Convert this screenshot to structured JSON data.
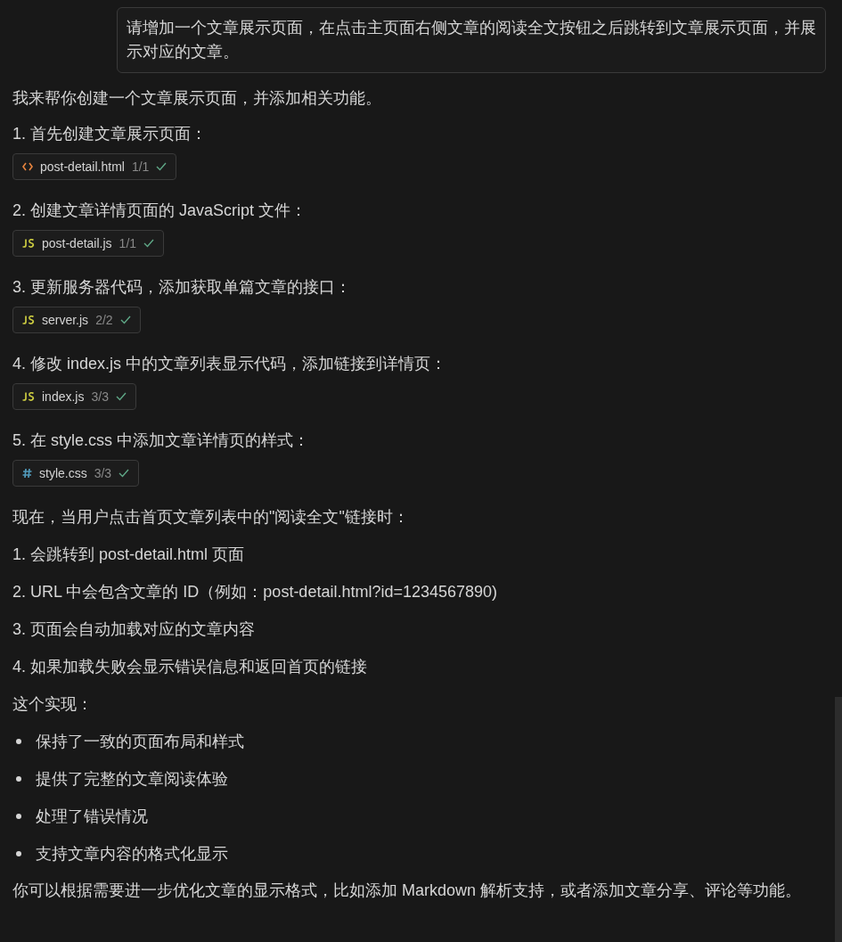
{
  "user_message": "请增加一个文章展示页面，在点击主页面右侧文章的阅读全文按钮之后跳转到文章展示页面，并展示对应的文章。",
  "reply": {
    "intro": "我来帮你创建一个文章展示页面，并添加相关功能。",
    "steps": [
      {
        "text": "1. 首先创建文章展示页面：",
        "file": {
          "kind": "html",
          "name": "post-detail.html",
          "count": "1/1",
          "done": true
        }
      },
      {
        "text": "2. 创建文章详情页面的 JavaScript 文件：",
        "file": {
          "kind": "js",
          "name": "post-detail.js",
          "count": "1/1",
          "done": true
        }
      },
      {
        "text": "3. 更新服务器代码，添加获取单篇文章的接口：",
        "file": {
          "kind": "js",
          "name": "server.js",
          "count": "2/2",
          "done": true
        }
      },
      {
        "text": "4. 修改 index.js 中的文章列表显示代码，添加链接到详情页：",
        "file": {
          "kind": "js",
          "name": "index.js",
          "count": "3/3",
          "done": true
        }
      },
      {
        "text": "5. 在 style.css 中添加文章详情页的样式：",
        "file": {
          "kind": "css",
          "name": "style.css",
          "count": "3/3",
          "done": true
        }
      }
    ],
    "summary_heading": "现在，当用户点击首页文章列表中的\"阅读全文\"链接时：",
    "summary_points": [
      "1. 会跳转到 post-detail.html 页面",
      "2. URL 中会包含文章的 ID（例如：post-detail.html?id=1234567890)",
      "3. 页面会自动加载对应的文章内容",
      "4. 如果加载失败会显示错误信息和返回首页的链接"
    ],
    "features_heading": "这个实现：",
    "features": [
      "保持了一致的页面布局和样式",
      "提供了完整的文章阅读体验",
      "处理了错误情况",
      "支持文章内容的格式化显示"
    ],
    "closing": "你可以根据需要进一步优化文章的显示格式，比如添加 Markdown 解析支持，或者添加文章分享、评论等功能。"
  }
}
